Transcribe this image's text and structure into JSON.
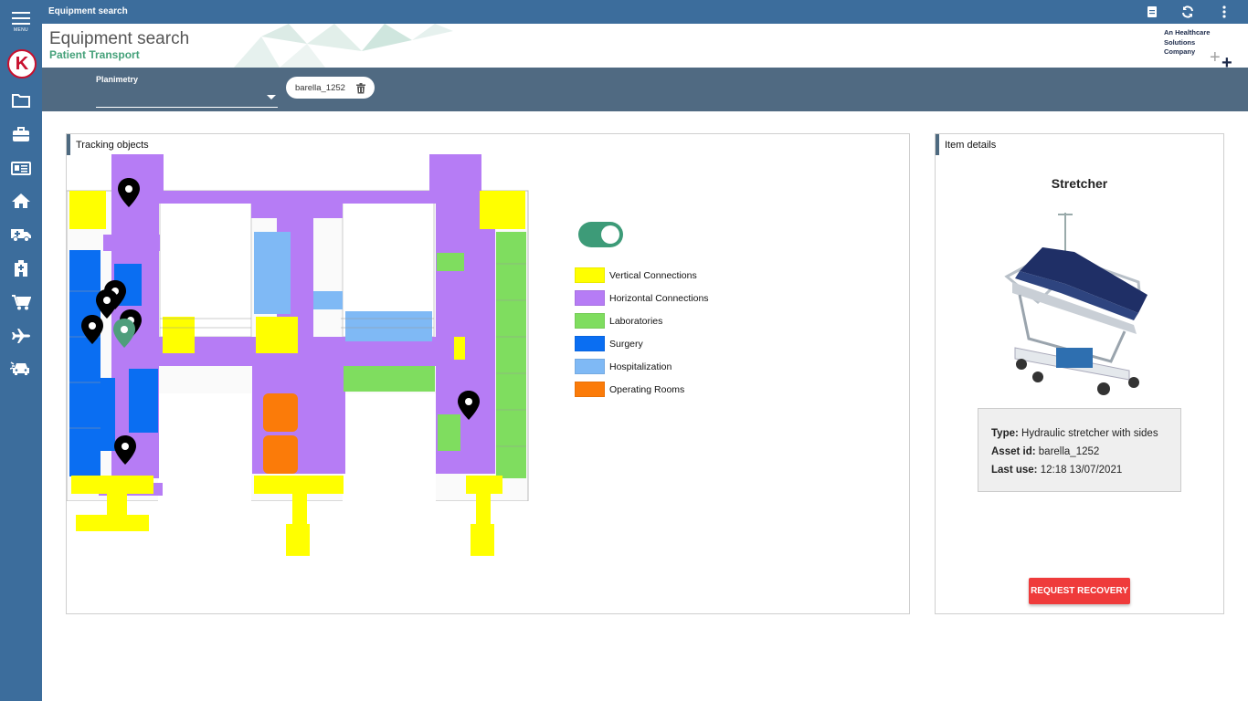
{
  "sidebar": {
    "menu_label": "MENU",
    "logo_letter": "K",
    "items": [
      {
        "icon": "folder-icon"
      },
      {
        "icon": "briefcase-icon"
      },
      {
        "icon": "id-card-icon"
      },
      {
        "icon": "home-icon"
      },
      {
        "icon": "ambulance-icon"
      },
      {
        "icon": "hospital-icon"
      },
      {
        "icon": "cart-icon"
      },
      {
        "icon": "airplane-icon"
      },
      {
        "icon": "car-crash-icon"
      }
    ]
  },
  "topbar": {
    "title": "Equipment search",
    "icons": [
      "clipboard-icon",
      "refresh-icon",
      "more-vertical-icon"
    ]
  },
  "header": {
    "title": "Equipment search",
    "subtitle": "Patient Transport",
    "brand_text": "An Healthcare Solutions Company"
  },
  "filters": {
    "planimetry_label": "Planimetry",
    "planimetry_value": "",
    "chip_label": "barella_1252"
  },
  "tracking": {
    "title": "Tracking objects",
    "toggle_on": true,
    "legend": [
      {
        "label": "Vertical Connections",
        "color": "#ffff00"
      },
      {
        "label": "Horizontal Connections",
        "color": "#b67cf5"
      },
      {
        "label": "Laboratories",
        "color": "#7fdd5f"
      },
      {
        "label": "Surgery",
        "color": "#0a6ef2"
      },
      {
        "label": "Hospitalization",
        "color": "#7fb9f5"
      },
      {
        "label": "Operating Rooms",
        "color": "#fb7b09"
      }
    ]
  },
  "details": {
    "title": "Item details",
    "item_name": "Stretcher",
    "type_label": "Type:",
    "type_value": "Hydraulic stretcher with sides",
    "asset_label": "Asset id:",
    "asset_value": "barella_1252",
    "lastuse_label": "Last use:",
    "lastuse_value": "12:18 13/07/2021",
    "button_label": "REQUEST RECOVERY"
  },
  "colors": {
    "sidebar": "#3c6d9c",
    "filterbar": "#506a82",
    "accent_green": "#45a17a",
    "button_red": "#ef3b3b"
  }
}
